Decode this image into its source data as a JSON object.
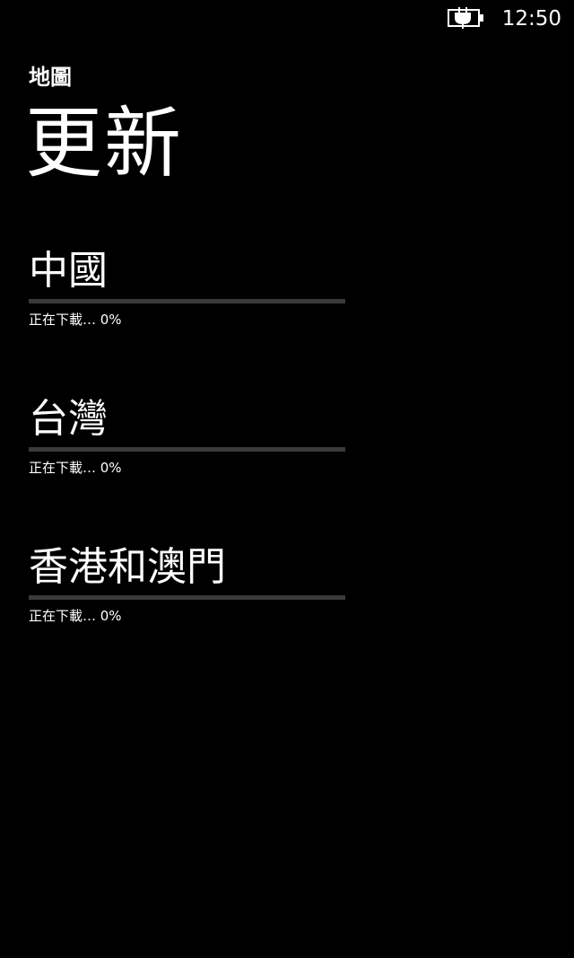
{
  "status_bar": {
    "time": "12:50",
    "battery_icon": "battery-charging-icon"
  },
  "header": {
    "app_title": "地圖",
    "page_title": "更新"
  },
  "regions": [
    {
      "name": "中國",
      "status": "正在下載… 0%",
      "progress": 0
    },
    {
      "name": "台灣",
      "status": "正在下載… 0%",
      "progress": 0
    },
    {
      "name": "香港和澳門",
      "status": "正在下載… 0%",
      "progress": 0
    }
  ],
  "colors": {
    "background": "#000000",
    "foreground": "#ffffff",
    "progress_track": "#3a3a3a"
  }
}
